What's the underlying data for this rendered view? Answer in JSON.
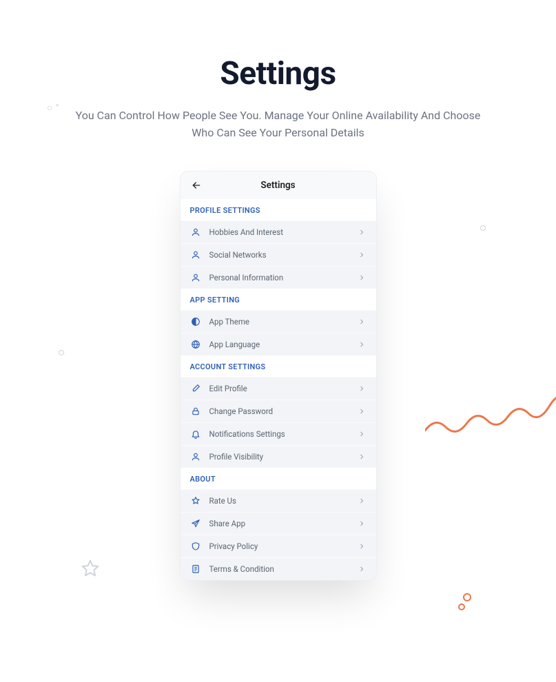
{
  "page": {
    "title": "Settings",
    "subtitle": "You Can Control How People See You. Manage Your Online Availability And Choose Who Can See Your Personal Details"
  },
  "phone": {
    "headerTitle": "Settings"
  },
  "sections": {
    "profile": {
      "title": "PROFILE SETTINGS",
      "items": {
        "hobbies": "Hobbies And Interest",
        "social": "Social Networks",
        "personal": "Personal Information"
      }
    },
    "app": {
      "title": "APP SETTING",
      "items": {
        "theme": "App Theme",
        "language": "App Language"
      }
    },
    "account": {
      "title": "ACCOUNT SETTINGS",
      "items": {
        "edit": "Edit Profile",
        "password": "Change Password",
        "notifications": "Notifications Settings",
        "visibility": "Profile Visibility"
      }
    },
    "about": {
      "title": "ABOUT",
      "items": {
        "rate": "Rate Us",
        "share": "Share App",
        "privacy": "Privacy Policy",
        "terms": "Terms & Condition"
      }
    }
  }
}
